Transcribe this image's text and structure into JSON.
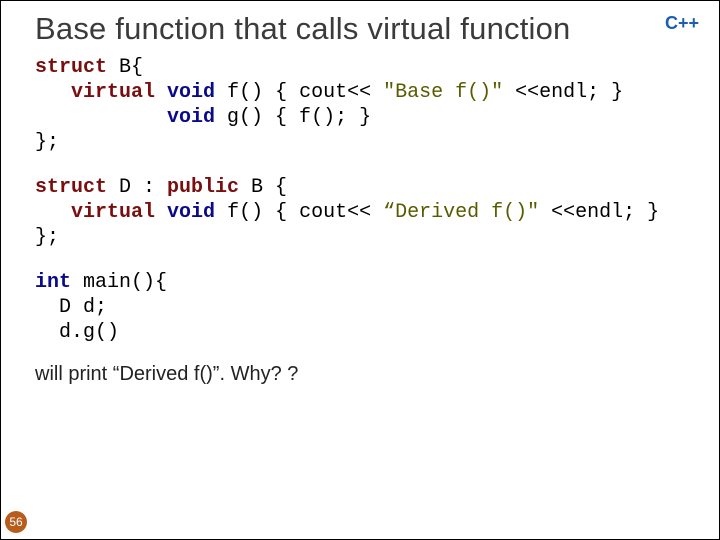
{
  "header": {
    "title": "Base function that calls virtual function",
    "language_badge": "C++"
  },
  "code": {
    "block1": {
      "l1_kw": "struct",
      "l1_rest": " B{",
      "l2_indent": "   ",
      "l2_kw": "virtual",
      "l2_mid": " ",
      "l2_kw2": "void",
      "l2_rest": " f() { cout<< ",
      "l2_str": "\"Base f()\"",
      "l2_tail": " <<endl; }",
      "l3_indent": "           ",
      "l3_kw": "void",
      "l3_rest": " g() { f(); }",
      "l4": "};"
    },
    "block2": {
      "l1_kw": "struct",
      "l1_mid": " D : ",
      "l1_kw2": "public",
      "l1_rest": " B {",
      "l2_indent": "   ",
      "l2_kw": "virtual",
      "l2_mid": " ",
      "l2_kw2": "void",
      "l2_rest": " f() { cout<< ",
      "l2_str": "“Derived f()\"",
      "l2_tail": " <<endl; }",
      "l3": "};"
    },
    "block3": {
      "l1_kw": "int",
      "l1_rest": " main(){",
      "l2": "  D d;",
      "l3": "  d.g()"
    }
  },
  "caption": "will print “Derived f()”. Why? ?",
  "page_number": "56"
}
